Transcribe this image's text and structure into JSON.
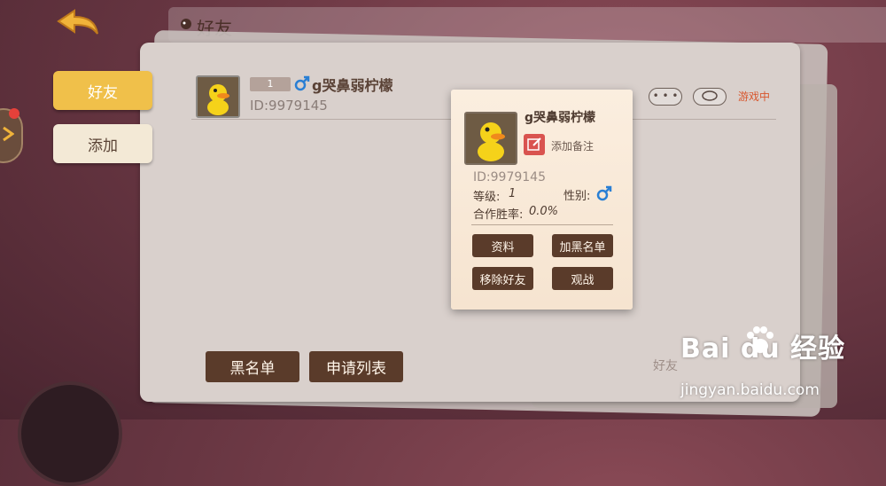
{
  "header": {
    "title": "好友"
  },
  "tabs": [
    {
      "label": "好友"
    },
    {
      "label": "添加"
    }
  ],
  "friend": {
    "name": "g哭鼻弱柠檬",
    "id_text": "ID:9979145",
    "level_badge": "1",
    "more_label": "• • •",
    "status": "游戏中"
  },
  "bottom": {
    "blacklist": "黑名单",
    "requests": "申请列表",
    "count_label": "好友"
  },
  "popup": {
    "name": "g哭鼻弱柠檬",
    "add_note": "添加备注",
    "id_text": "ID:9979145",
    "level_label": "等级:",
    "level_value": "1",
    "gender_label": "性别:",
    "winrate_label": "合作胜率:",
    "winrate_value": "0.0%",
    "buttons": {
      "profile": "资料",
      "block": "加黑名单",
      "remove": "移除好友",
      "watch": "观战"
    }
  },
  "watermark": {
    "logo": "Bai  du 经验",
    "url": "jingyan.baidu.com"
  },
  "colors": {
    "accent_tab": "#f0c04a",
    "button_dark": "#5a3b2a",
    "status": "#d8572e",
    "gender_male": "#2a7fd4"
  }
}
